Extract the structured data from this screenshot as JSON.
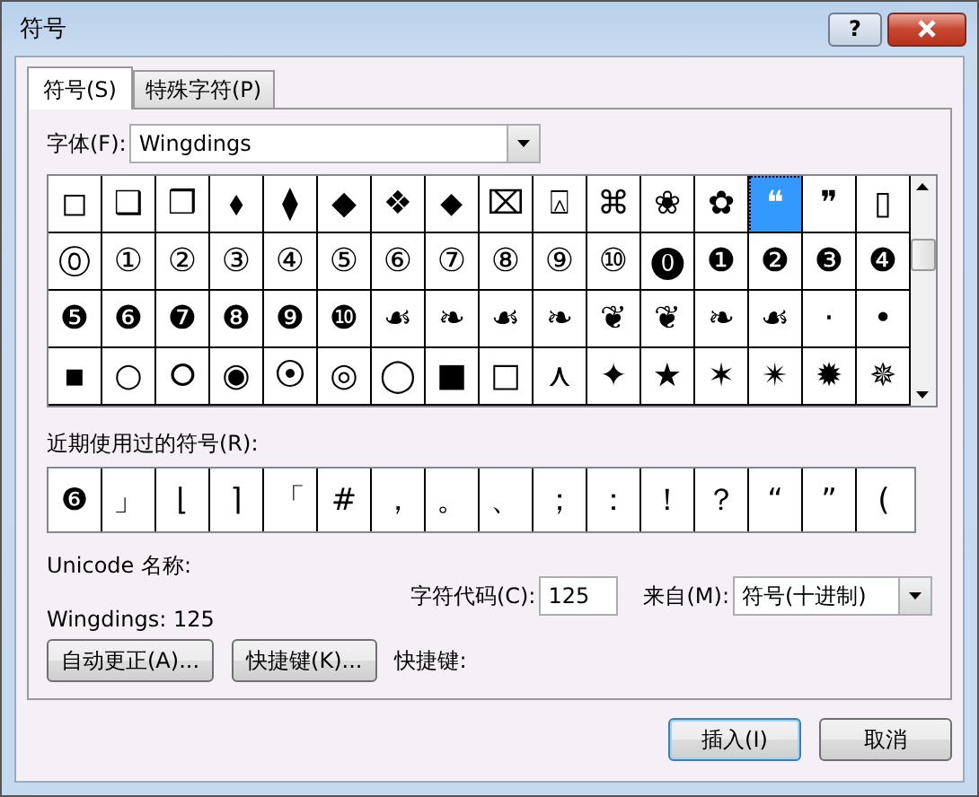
{
  "window": {
    "title": "符号",
    "help_button": "?"
  },
  "tabs": [
    {
      "label": "符号(S)",
      "selected": true
    },
    {
      "label": "特殊字符(P)",
      "selected": false
    }
  ],
  "font": {
    "label": "字体(F):",
    "value": "Wingdings"
  },
  "symbol_grid": [
    [
      {
        "char": "◻",
        "selected": false
      },
      {
        "char": "❑",
        "selected": false
      },
      {
        "char": "❒",
        "selected": false
      },
      {
        "char": "⬧",
        "selected": false
      },
      {
        "char": "⧫",
        "selected": false
      },
      {
        "char": "◆",
        "selected": false
      },
      {
        "char": "❖",
        "selected": false
      },
      {
        "char": "⬥",
        "selected": false
      },
      {
        "char": "⌧",
        "selected": false
      },
      {
        "char": "⍓",
        "selected": false
      },
      {
        "char": "⌘",
        "selected": false
      },
      {
        "char": "❀",
        "selected": false
      },
      {
        "char": "✿",
        "selected": false
      },
      {
        "char": "❝",
        "selected": true
      },
      {
        "char": "❞",
        "selected": false
      },
      {
        "char": "▯",
        "selected": false
      }
    ],
    [
      {
        "char": "⓪",
        "selected": false
      },
      {
        "char": "①",
        "selected": false
      },
      {
        "char": "②",
        "selected": false
      },
      {
        "char": "③",
        "selected": false
      },
      {
        "char": "④",
        "selected": false
      },
      {
        "char": "⑤",
        "selected": false
      },
      {
        "char": "⑥",
        "selected": false
      },
      {
        "char": "⑦",
        "selected": false
      },
      {
        "char": "⑧",
        "selected": false
      },
      {
        "char": "⑨",
        "selected": false
      },
      {
        "char": "⑩",
        "selected": false
      },
      {
        "char": "⓿",
        "selected": false
      },
      {
        "char": "❶",
        "selected": false
      },
      {
        "char": "❷",
        "selected": false
      },
      {
        "char": "❸",
        "selected": false
      },
      {
        "char": "❹",
        "selected": false
      }
    ],
    [
      {
        "char": "❺",
        "selected": false
      },
      {
        "char": "❻",
        "selected": false
      },
      {
        "char": "❼",
        "selected": false
      },
      {
        "char": "❽",
        "selected": false
      },
      {
        "char": "❾",
        "selected": false
      },
      {
        "char": "❿",
        "selected": false
      },
      {
        "char": "☙",
        "selected": false
      },
      {
        "char": "❧",
        "selected": false
      },
      {
        "char": "☙",
        "selected": false
      },
      {
        "char": "❧",
        "selected": false
      },
      {
        "char": "❦",
        "selected": false
      },
      {
        "char": "❦",
        "selected": false
      },
      {
        "char": "❧",
        "selected": false
      },
      {
        "char": "☙",
        "selected": false
      },
      {
        "char": "·",
        "selected": false
      },
      {
        "char": "•",
        "selected": false
      }
    ],
    [
      {
        "char": "▪",
        "selected": false
      },
      {
        "char": "○",
        "selected": false
      },
      {
        "char": "⭘",
        "selected": false
      },
      {
        "char": "◉",
        "selected": false
      },
      {
        "char": "⦿",
        "selected": false
      },
      {
        "char": "◎",
        "selected": false
      },
      {
        "char": "◯",
        "selected": false
      },
      {
        "char": "■",
        "selected": false
      },
      {
        "char": "□",
        "selected": false
      },
      {
        "char": "⋏",
        "selected": false
      },
      {
        "char": "✦",
        "selected": false
      },
      {
        "char": "★",
        "selected": false
      },
      {
        "char": "✶",
        "selected": false
      },
      {
        "char": "✴",
        "selected": false
      },
      {
        "char": "✹",
        "selected": false
      },
      {
        "char": "✵",
        "selected": false
      }
    ]
  ],
  "recent": {
    "label": "近期使用过的符号(R):",
    "symbols": [
      "❻",
      "」",
      "⌊",
      "⌉",
      "「",
      "#",
      "，",
      "。",
      "、",
      "；",
      "：",
      "！",
      "？",
      "“",
      "”",
      "("
    ]
  },
  "unicode_name": {
    "label": "Unicode 名称:",
    "value": "Wingdings: 125"
  },
  "char_code": {
    "label": "字符代码(C):",
    "value": "125"
  },
  "from": {
    "label": "来自(M):",
    "value": "符号(十进制)"
  },
  "buttons": [
    {
      "label": "自动更正(A)..."
    },
    {
      "label": "快捷键(K)..."
    }
  ],
  "shortcut_label": "快捷键:",
  "footer_buttons": [
    {
      "label": "插入(I)",
      "default": true
    },
    {
      "label": "取消",
      "default": false
    }
  ]
}
